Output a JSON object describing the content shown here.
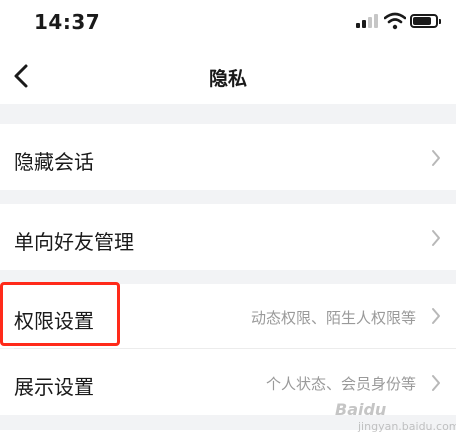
{
  "status_bar": {
    "time": "14:37"
  },
  "nav": {
    "title": "隐私"
  },
  "rows": [
    {
      "label": "隐藏会话",
      "sub": ""
    },
    {
      "label": "单向好友管理",
      "sub": ""
    },
    {
      "label": "权限设置",
      "sub": "动态权限、陌生人权限等"
    },
    {
      "label": "展示设置",
      "sub": "个人状态、会员身份等"
    }
  ],
  "colors": {
    "highlight": "#ff2a1a",
    "background": "#f2f3f5"
  },
  "watermark": {
    "brand": "Baidu",
    "sub": "jingyan.baidu.com"
  }
}
